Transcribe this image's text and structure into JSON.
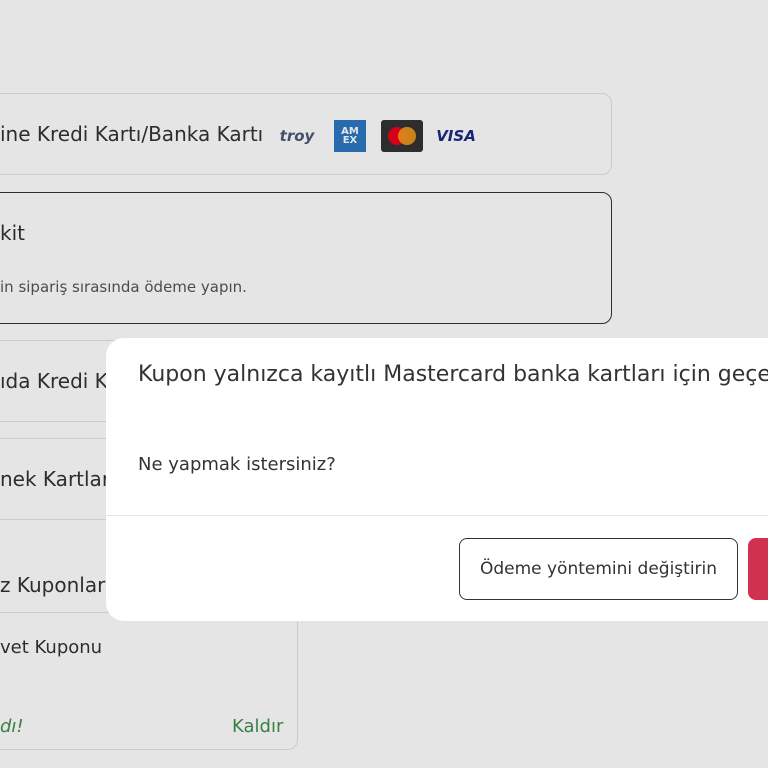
{
  "payment_options": {
    "card_online": {
      "label": "ine Kredi Kartı/Banka Kartı"
    },
    "cash": {
      "label": "kit",
      "description": "in sipariş sırasında ödeme yapın."
    },
    "credit_card_door": {
      "label": "ıda Kredi K"
    },
    "meal_cards": {
      "label": "nek Kartları"
    }
  },
  "card_logos": {
    "troy": "troy",
    "amex_top": "AM",
    "amex_bottom": "EX",
    "visa": "VISA"
  },
  "coupons": {
    "heading": "z Kuponlar",
    "coupon_name": "vet Kuponu",
    "status": "dı!",
    "remove_label": "Kaldır"
  },
  "modal": {
    "title": "Kupon yalnızca kayıtlı Mastercard banka kartları için geçerl",
    "question": "Ne yapmak istersiniz?",
    "change_payment_label": "Ödeme yöntemini değiştirin"
  },
  "colors": {
    "primary": "#d0314f",
    "link_green": "#3f8f4f",
    "mastercard_red": "#eb001b",
    "mastercard_orange": "#f79e1b"
  }
}
